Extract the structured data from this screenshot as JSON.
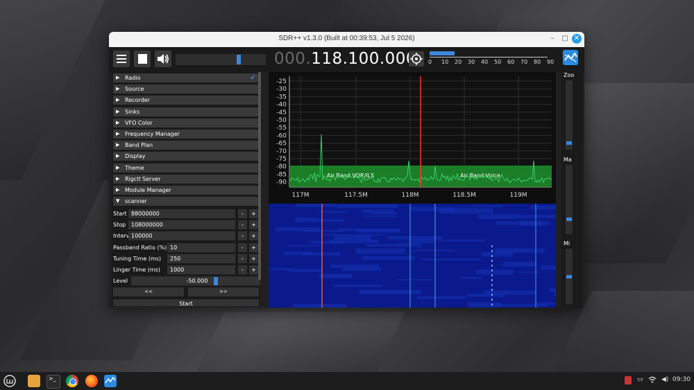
{
  "window": {
    "title": "SDR++ v1.3.0 (Built at 00:39:53, Jul  5 2026)",
    "minimize": "–",
    "maximize": "□",
    "close": "✕"
  },
  "toolbar": {
    "menu_icon": "hamburger-icon",
    "stop_icon": "stop-icon",
    "volume_icon": "speaker-icon",
    "volume_level": 0.7,
    "frequency_prefix": "000.",
    "frequency_main": "118.100.000",
    "target_icon": "crosshair-icon",
    "snr_level": 0.2,
    "snr_ticks": [
      "0",
      "10",
      "20",
      "30",
      "40",
      "50",
      "60",
      "70",
      "80",
      "90"
    ],
    "app_icon": "sdrpp-logo"
  },
  "menu": {
    "items": [
      {
        "label": "Radio",
        "arrow": "▶",
        "checked": true
      },
      {
        "label": "Source",
        "arrow": "▶"
      },
      {
        "label": "Recorder",
        "arrow": "▶"
      },
      {
        "label": "Sinks",
        "arrow": "▶"
      },
      {
        "label": "VFO Color",
        "arrow": "▶"
      },
      {
        "label": "Frequency Manager",
        "arrow": "▶"
      },
      {
        "label": "Band Plan",
        "arrow": "▶"
      },
      {
        "label": "Display",
        "arrow": "▶"
      },
      {
        "label": "Theme",
        "arrow": "▶"
      },
      {
        "label": "Rigctl Server",
        "arrow": "▶"
      },
      {
        "label": "Module Manager",
        "arrow": "▶"
      },
      {
        "label": "scanner",
        "arrow": "▼"
      }
    ],
    "check_glyph": "✔"
  },
  "scanner": {
    "fields": [
      {
        "label": "Start",
        "value": "88000000"
      },
      {
        "label": "Stop",
        "value": "108000000"
      },
      {
        "label": "Interval",
        "value": "100000"
      },
      {
        "label": "Passband Ratio (%)",
        "value": "10"
      },
      {
        "label": "Tuning Time (ms)",
        "value": "250"
      },
      {
        "label": "Linger Time (ms)",
        "value": "1000"
      }
    ],
    "minus": "-",
    "plus": "+",
    "level_label": "Level",
    "level_value": "-50.000",
    "prev": "<<",
    "next": ">>",
    "start": "Start"
  },
  "fft": {
    "y_ticks": [
      "-25",
      "-30",
      "-35",
      "-40",
      "-45",
      "-50",
      "-55",
      "-60",
      "-65",
      "-70",
      "-75",
      "-80",
      "-85",
      "-90"
    ],
    "x_ticks": [
      "117M",
      "117.5M",
      "118M",
      "118.5M",
      "119M"
    ],
    "bands": [
      "Air Band VOR/ILS",
      "Air Band Voice"
    ]
  },
  "side": {
    "zoom": "Zoo",
    "max": "Ma",
    "min": "Mi"
  },
  "colors": {
    "accent": "#3d87d8",
    "band": "#1e8a2a",
    "trace": "#3cd06a",
    "vfo": "#ff3030",
    "waterfall": "#0a1a8c"
  },
  "taskbar": {
    "icons": [
      "mint-menu-icon",
      "files-icon",
      "terminal-icon",
      "chrome-icon",
      "firefox-icon",
      "sdrpp-icon"
    ],
    "clock": "09:30"
  }
}
